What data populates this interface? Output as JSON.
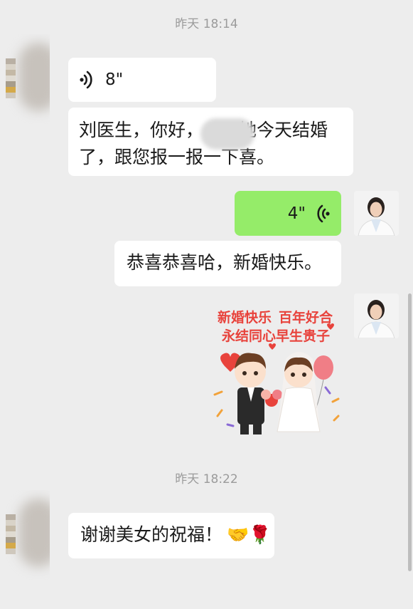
{
  "messages": {
    "timestamp_1": "昨天 18:14",
    "voice_in_duration": "8\"",
    "text_in_1": "刘医生，你好，",
    "text_in_1b": "她今天结婚",
    "text_in_1c": "了，跟您报一报一下喜。",
    "voice_out_duration": "4\"",
    "text_out_1": "恭喜恭喜哈，新婚快乐。",
    "sticker": {
      "line1_left": "新婚快乐",
      "line1_right": "百年好合",
      "line2_left": "永结同心",
      "line2_right": "早生贵子"
    },
    "timestamp_2": "昨天 18:22",
    "text_in_2": "谢谢美女的祝福！",
    "text_in_2_emoji": "🤝🌹"
  },
  "colors": {
    "background": "#ededed",
    "incoming_bubble": "#ffffff",
    "outgoing_bubble": "#95ec69",
    "timestamp": "#9b9b9b",
    "sticker_text": "#e8433c"
  },
  "icons": [
    "voice-wave-icon",
    "avatar-blurred",
    "avatar-doctor"
  ]
}
